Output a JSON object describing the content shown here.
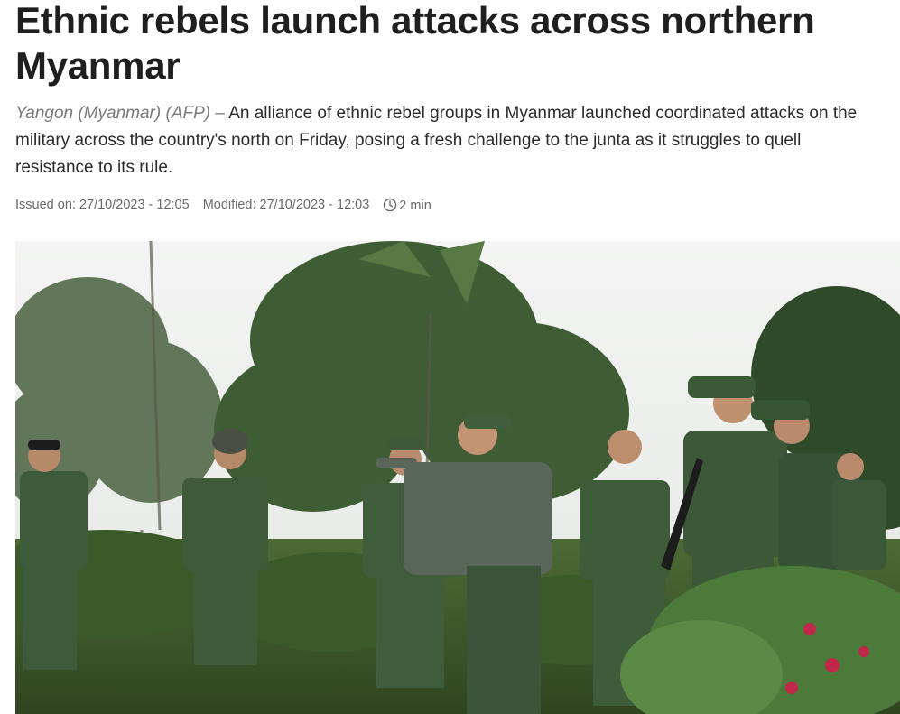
{
  "article": {
    "headline": "Ethnic rebels launch attacks across northern Myanmar",
    "dateline": "Yangon (Myanmar) (AFP)",
    "dateline_separator": "–",
    "lead": "An alliance of ethnic rebel groups in Myanmar launched coordinated attacks on the military across the country's north on Friday, posing a fresh challenge to the junta as it struggles to quell resistance to its rule.",
    "issued": "Issued on: 27/10/2023 - 12:05",
    "modified": "Modified: 27/10/2023 - 12:03",
    "read_time": "2 min",
    "read_time_icon": "clock-icon"
  },
  "photo": {
    "subject": "soldiers-in-jungle-photo",
    "colors": {
      "sky": "#eef0ee",
      "foliage_dark": "#2f4a2a",
      "foliage_mid": "#4f6e3e",
      "uniform": "#3d5a3a",
      "ground": "#3f5b2e",
      "flowers": "#c0284a"
    }
  }
}
